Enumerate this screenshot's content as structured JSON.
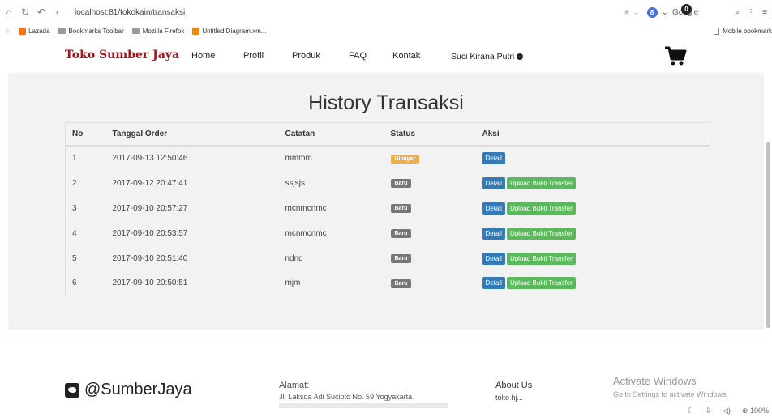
{
  "browser": {
    "url": "localhost:81/tokokain/transaksi",
    "search_engine": "Google",
    "search_engine_initial": "8",
    "bookmarks": [
      {
        "label": "Lazada",
        "color": "#f57224"
      },
      {
        "label": "Bookmarks Toolbar",
        "color": "#9a9a9a"
      },
      {
        "label": "Mozilla Firefox",
        "color": "#9a9a9a"
      },
      {
        "label": "Untitled Diagram.xm...",
        "color": "#f08705"
      }
    ],
    "mobile_bookmarks": "Mobile bookmark",
    "zoom": "100%"
  },
  "site": {
    "brand": "Toko Sumber Jaya",
    "nav": [
      "Home",
      "Profil",
      "Produk",
      "FAQ",
      "Kontak"
    ],
    "user": "Suci Kirana Putri",
    "cart_count": "0"
  },
  "page": {
    "title": "History Transaksi",
    "columns": [
      "No",
      "Tanggal Order",
      "Catatan",
      "Status",
      "Aksi"
    ],
    "rows": [
      {
        "no": "1",
        "date": "2017-09-13 12:50:46",
        "note": "mmmm",
        "status": "Dibayar",
        "detail": "Detail",
        "upload": ""
      },
      {
        "no": "2",
        "date": "2017-09-12 20:47:41",
        "note": "ssjsjs",
        "status": "Baru",
        "detail": "Detail",
        "upload": "Upload Bukti Transfer"
      },
      {
        "no": "3",
        "date": "2017-09-10 20:57:27",
        "note": "mcnmcnmc",
        "status": "Baru",
        "detail": "Detail",
        "upload": "Upload Bukti Transfer"
      },
      {
        "no": "4",
        "date": "2017-09-10 20:53:57",
        "note": "mcnmcnmc",
        "status": "Baru",
        "detail": "Detail",
        "upload": "Upload Bukti Transfer"
      },
      {
        "no": "5",
        "date": "2017-09-10 20:51:40",
        "note": "ndnd",
        "status": "Baru",
        "detail": "Detail",
        "upload": "Upload Bukti Transfer"
      },
      {
        "no": "6",
        "date": "2017-09-10 20:50:51",
        "note": "mjm",
        "status": "Baru",
        "detail": "Detail",
        "upload": "Upload Bukti Transfer"
      }
    ]
  },
  "footer": {
    "social_handle": "@SumberJaya",
    "address_label": "Alamat:",
    "address": "Jl. Laksda Adi Sucipto No. 59 Yogyakarta",
    "about_label": "About Us",
    "about_text": "toko hj..."
  },
  "windows_watermark": {
    "title": "Activate Windows",
    "subtitle": "Go to Settings to activate Windows."
  },
  "colors": {
    "brand": "#a5141a",
    "paid": "#f0ad4e",
    "new": "#777777",
    "detail": "#337ab7",
    "upload": "#5cb85c"
  }
}
